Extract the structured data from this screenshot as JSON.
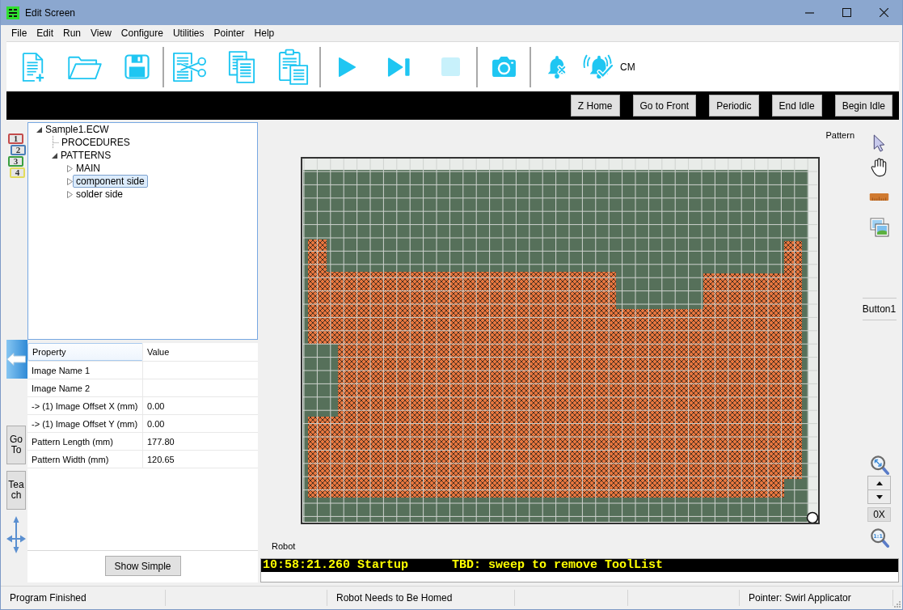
{
  "window": {
    "title": "Edit Screen"
  },
  "menu": [
    "File",
    "Edit",
    "Run",
    "View",
    "Configure",
    "Utilities",
    "Pointer",
    "Help"
  ],
  "toolbar": [
    {
      "buttons": [
        {
          "kind": "new",
          "disabled": false
        },
        {
          "kind": "open",
          "disabled": false
        },
        {
          "kind": "save",
          "disabled": false
        }
      ]
    },
    {
      "buttons": [
        {
          "kind": "cut",
          "disabled": false
        },
        {
          "kind": "copy",
          "disabled": false
        },
        {
          "kind": "paste",
          "disabled": false
        }
      ]
    },
    {
      "buttons": [
        {
          "kind": "run",
          "disabled": false
        },
        {
          "kind": "step",
          "disabled": false
        },
        {
          "kind": "stop",
          "disabled": true
        }
      ]
    },
    {
      "buttons": [
        {
          "kind": "camera",
          "disabled": false
        }
      ]
    },
    {
      "buttons": [
        {
          "kind": "alarm-off",
          "disabled": false
        },
        {
          "kind": "alarm-on",
          "disabled": false,
          "label": "CM"
        }
      ]
    }
  ],
  "command_bar": [
    "Z Home",
    "Go to Front",
    "Periodic",
    "End Idle",
    "Begin Idle"
  ],
  "layer_tags": [
    {
      "label": "1",
      "color": "#c44c4c"
    },
    {
      "label": "2",
      "color": "#4a7fb8"
    },
    {
      "label": "3",
      "color": "#3aa040"
    },
    {
      "label": "4",
      "color": "#e2dc5c"
    }
  ],
  "side_buttons": [
    "Go To",
    "Teach"
  ],
  "tree": [
    {
      "label": "Sample1.ECW",
      "kind": "node",
      "expanded": true,
      "selected": false,
      "children": [
        {
          "label": "PROCEDURES",
          "kind": "leaf",
          "selected": false
        },
        {
          "label": "PATTERNS",
          "kind": "node",
          "expanded": true,
          "selected": false,
          "children": [
            {
              "label": "MAIN",
              "kind": "node",
              "expanded": false,
              "selected": false
            },
            {
              "label": "component side",
              "kind": "node",
              "expanded": false,
              "selected": true
            },
            {
              "label": "solder side",
              "kind": "node",
              "expanded": false,
              "selected": false
            }
          ]
        }
      ]
    }
  ],
  "properties": {
    "columns": [
      "Property",
      "Value"
    ],
    "rows": [
      {
        "name": "Image Name 1"
      },
      {
        "name": "Image Name 2"
      },
      {
        "name": "-> (1) Image Offset X (mm)",
        "value": "0.00"
      },
      {
        "name": "-> (1) Image Offset Y (mm)",
        "value": "0.00"
      },
      {
        "name": "Pattern Length (mm)",
        "value": "177.80"
      },
      {
        "name": "Pattern Width (mm)",
        "value": "120.65"
      }
    ]
  },
  "show_simple_button": "Show Simple",
  "canvas": {
    "label": "Pattern"
  },
  "right_toolbar": {
    "button": "Button1",
    "zoom_readout": "0X",
    "actual_size": "1:1"
  },
  "log": {
    "label": "Robot",
    "lines": [
      "10:58:21.260 Startup      TBD: sweep to remove ToolList"
    ]
  },
  "status_bar": [
    "Program Finished",
    "Robot Needs to Be Homed",
    "Pointer: Swirl Applicator"
  ]
}
